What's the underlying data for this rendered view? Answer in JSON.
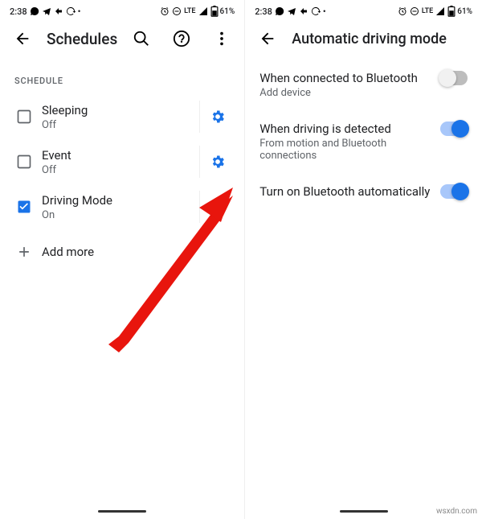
{
  "status": {
    "time": "2:38",
    "network": "LTE",
    "battery": "61%"
  },
  "left": {
    "title": "Schedules",
    "section": "SCHEDULE",
    "rows": [
      {
        "title": "Sleeping",
        "sub": "Off",
        "checked": false
      },
      {
        "title": "Event",
        "sub": "Off",
        "checked": false
      },
      {
        "title": "Driving Mode",
        "sub": "On",
        "checked": true
      }
    ],
    "add": "Add more"
  },
  "right": {
    "title": "Automatic driving mode",
    "rows": [
      {
        "title": "When connected to Bluetooth",
        "sub": "Add device",
        "on": false
      },
      {
        "title": "When driving is detected",
        "sub": "From motion and Bluetooth connections",
        "on": true
      },
      {
        "title": "Turn on Bluetooth automatically",
        "sub": "",
        "on": true
      }
    ]
  },
  "watermark": "wsxdn.com"
}
